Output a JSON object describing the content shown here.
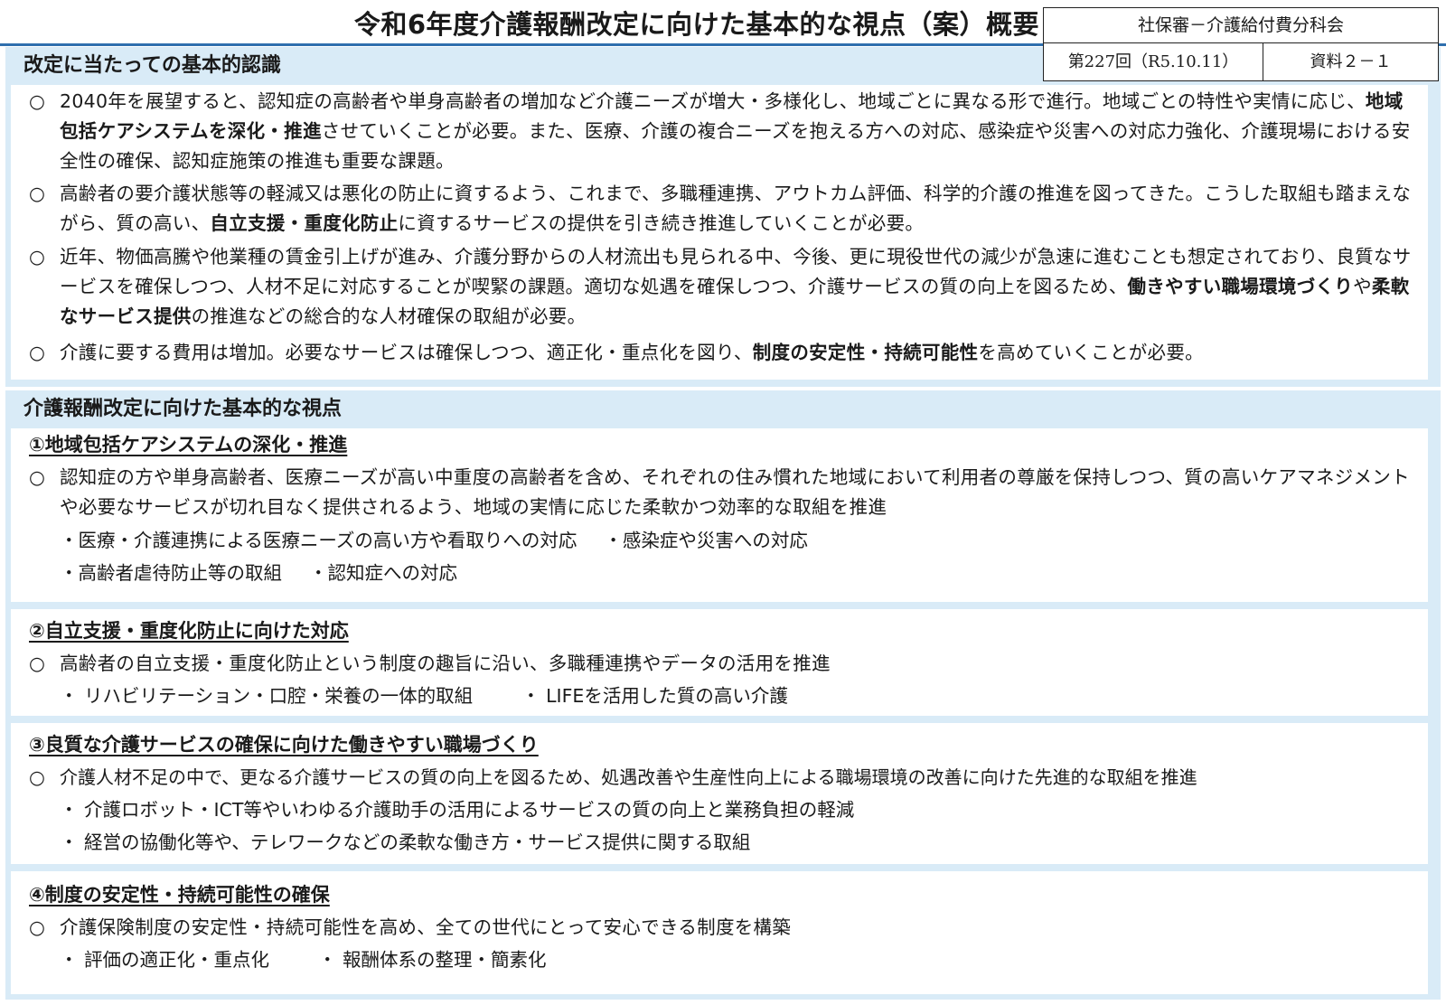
{
  "header": {
    "title": "令和6年度介護報酬改定に向けた基本的な視点（案）概要",
    "meta_org": "社保審－介護給付費分科会",
    "meta_session": "第227回（R5.10.11）",
    "meta_doc": "資料２－１"
  },
  "recognition": {
    "heading": "改定に当たっての基本的認識",
    "mark": "○",
    "p1": {
      "a": "2040年を展望すると、認知症の高齢者や単身高齢者の増加など介護ニーズが増大・多様化し、地域ごとに異なる形で進行。地域ごとの特性や実情に応じ、",
      "b": "地域包括ケアシステムを深化・推進",
      "c": "させていくことが必要。また、医療、介護の複合ニーズを抱える方への対応、感染症や災害への対応力強化、介護現場における安全性の確保、認知症施策の推進も重要な課題。"
    },
    "p2": {
      "a": "高齢者の要介護状態等の軽減又は悪化の防止に資するよう、これまで、多職種連携、アウトカム評価、科学的介護の推進を図ってきた。こうした取組も踏まえながら、質の高い、",
      "b": "自立支援・重度化防止",
      "c": "に資するサービスの提供を引き続き推進していくことが必要。"
    },
    "p3": {
      "a": "近年、物価高騰や他業種の賃金引上げが進み、介護分野からの人材流出も見られる中、今後、更に現役世代の減少が急速に進むことも想定されており、良質なサービスを確保しつつ、人材不足に対応することが喫緊の課題。適切な処遇を確保しつつ、介護サービスの質の向上を図るため、",
      "b": "働きやすい職場環境づくり",
      "c": "や",
      "d": "柔軟なサービス提供",
      "e": "の推進などの総合的な人材確保の取組が必要。"
    },
    "p4": {
      "a": "介護に要する費用は増加。必要なサービスは確保しつつ、適正化・重点化を図り、",
      "b": "制度の安定性・持続可能性",
      "c": "を高めていくことが必要。"
    }
  },
  "viewpoints": {
    "heading": "介護報酬改定に向けた基本的な視点",
    "mark": "○",
    "v1": {
      "title": "①地域包括ケアシステムの深化・推進",
      "text": "認知症の方や単身高齢者、医療ニーズが高い中重度の高齢者を含め、それぞれの住み慣れた地域において利用者の尊厳を保持しつつ、質の高いケアマネジメントや必要なサービスが切れ目なく提供されるよう、地域の実情に応じた柔軟かつ効率的な取組を推進",
      "b1": "・医療・介護連携による医療ニーズの高い方や看取りへの対応",
      "b2": "・感染症や災害への対応",
      "b3": "・高齢者虐待防止等の取組",
      "b4": "・認知症への対応"
    },
    "v2": {
      "title": "②自立支援・重度化防止に向けた対応",
      "text": "高齢者の自立支援・重度化防止という制度の趣旨に沿い、多職種連携やデータの活用を推進",
      "b1": "・ リハビリテーション・口腔・栄養の一体的取組",
      "b2": "・ LIFEを活用した質の高い介護"
    },
    "v3": {
      "title": "③良質な介護サービスの確保に向けた働きやすい職場づくり",
      "text": "介護人材不足の中で、更なる介護サービスの質の向上を図るため、処遇改善や生産性向上による職場環境の改善に向けた先進的な取組を推進",
      "b1": "・ 介護ロボット・ICT等やいわゆる介護助手の活用によるサービスの質の向上と業務負担の軽減",
      "b2": "・ 経営の協働化等や、テレワークなどの柔軟な働き方・サービス提供に関する取組"
    },
    "v4": {
      "title": "④制度の安定性・持続可能性の確保",
      "text": "介護保険制度の安定性・持続可能性を高め、全ての世代にとって安心できる制度を構築",
      "b1": "・ 評価の適正化・重点化",
      "b2": "・ 報酬体系の整理・簡素化"
    }
  }
}
